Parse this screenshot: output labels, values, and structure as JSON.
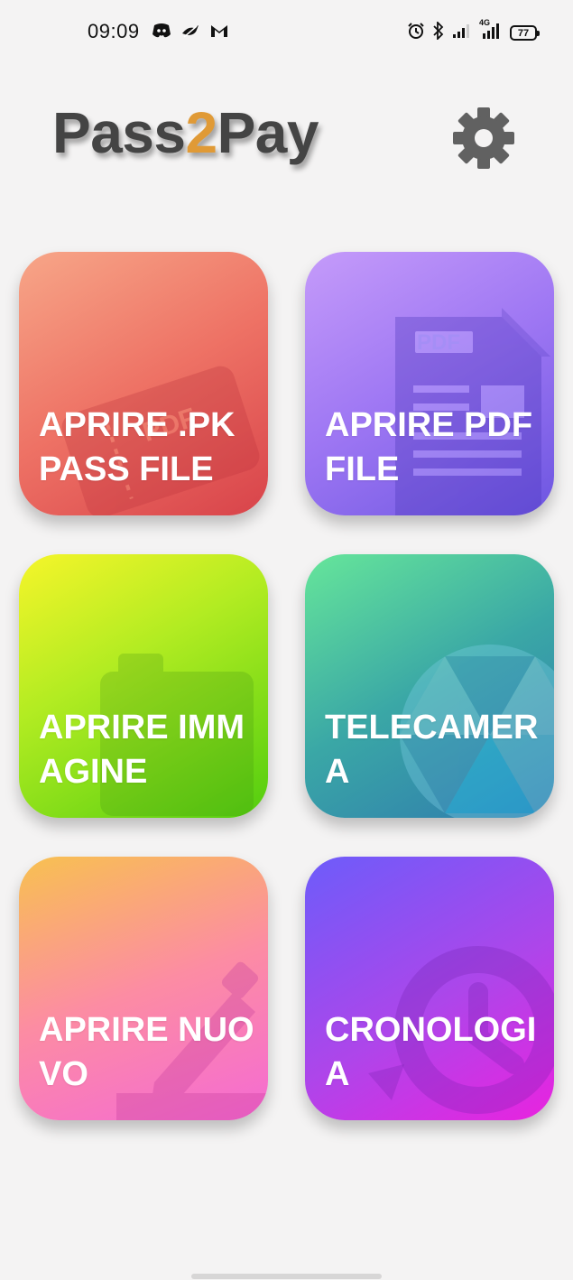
{
  "status_bar": {
    "time": "09:09",
    "left_icons": [
      "discord-icon",
      "bird-icon",
      "gmail-icon"
    ],
    "right_icons": [
      "alarm-icon",
      "bluetooth-icon",
      "signal-icon",
      "4g-signal-icon"
    ],
    "network_label": "4G",
    "battery_level": "77"
  },
  "header": {
    "title_part1": "Pass",
    "title_accent": "2",
    "title_part2": "Pay",
    "accent_color": "#e09a36",
    "settings_icon": "gear-icon"
  },
  "tiles": [
    {
      "label": "APRIRE .PKPASS FILE",
      "icon": "ticket-icon",
      "badge": "ticket"
    },
    {
      "label": "APRIRE PDF FILE",
      "icon": "pdf-file-icon",
      "badge": "PDF"
    },
    {
      "label": "APRIRE IMMAGINE",
      "icon": "image-icon"
    },
    {
      "label": "TELECAMERA",
      "icon": "camera-aperture-icon"
    },
    {
      "label": "APRIRE NUOVO",
      "icon": "pencil-icon"
    },
    {
      "label": "CRONOLOGIA",
      "icon": "history-icon"
    }
  ]
}
